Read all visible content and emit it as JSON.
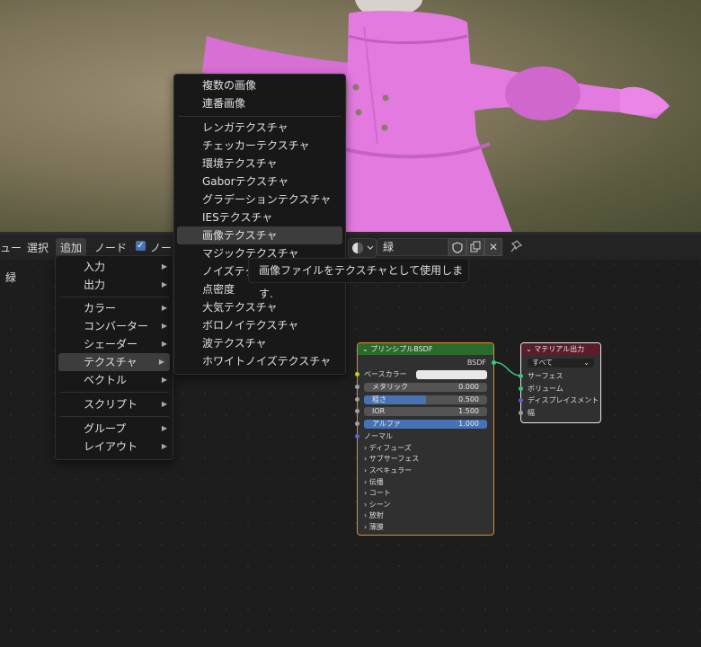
{
  "header": {
    "view_partial": "ュー",
    "select": "選択",
    "add": "追加",
    "node": "ノード",
    "checkbox_label_partial": "ノー",
    "material_name": "緑",
    "side_label": "緑"
  },
  "add_menu": {
    "items": [
      "入力",
      "出力",
      "カラー",
      "コンバーター",
      "シェーダー",
      "テクスチャ",
      "ベクトル",
      "スクリプト",
      "グループ",
      "レイアウト"
    ]
  },
  "texture_menu": {
    "items": [
      "複数の画像",
      "連番画像",
      "レンガテクスチャ",
      "チェッカーテクスチャ",
      "環境テクスチャ",
      "Gaborテクスチャ",
      "グラデーションテクスチャ",
      "IESテクスチャ",
      "画像テクスチャ",
      "マジックテクスチャ",
      "ノイズテクスチャ",
      "点密度",
      "大気テクスチャ",
      "ボロノイテクスチャ",
      "波テクスチャ",
      "ホワイトノイズテクスチャ"
    ]
  },
  "tooltip": "画像ファイルをテクスチャとして使用します.",
  "bsdf_node": {
    "title": "プリンシプルBSDF",
    "output": "BSDF",
    "base_color": "ベースカラー",
    "metallic": {
      "label": "メタリック",
      "value": "0.000",
      "fraction": 0
    },
    "roughness": {
      "label": "粗さ",
      "value": "0.500",
      "fraction": 0.5
    },
    "ior": {
      "label": "IOR",
      "value": "1.500",
      "fraction": 0
    },
    "alpha": {
      "label": "アルファ",
      "value": "1.000",
      "fraction": 1
    },
    "normal": "ノーマル",
    "sections": [
      "ディフューズ",
      "サブサーフェス",
      "スペキュラー",
      "伝播",
      "コート",
      "シーン",
      "放射",
      "薄膜"
    ]
  },
  "output_node": {
    "title": "マテリアル出力",
    "target": "すべて",
    "inputs": [
      "サーフェス",
      "ボリューム",
      "ディスプレイスメント",
      "幅"
    ]
  },
  "colors": {
    "accent": "#4772b3",
    "node_active_border": "#e58a2e",
    "bsdf_header": "#2a6a2a",
    "output_header": "#5a1d2a",
    "character_pink": "#e27ae0"
  }
}
